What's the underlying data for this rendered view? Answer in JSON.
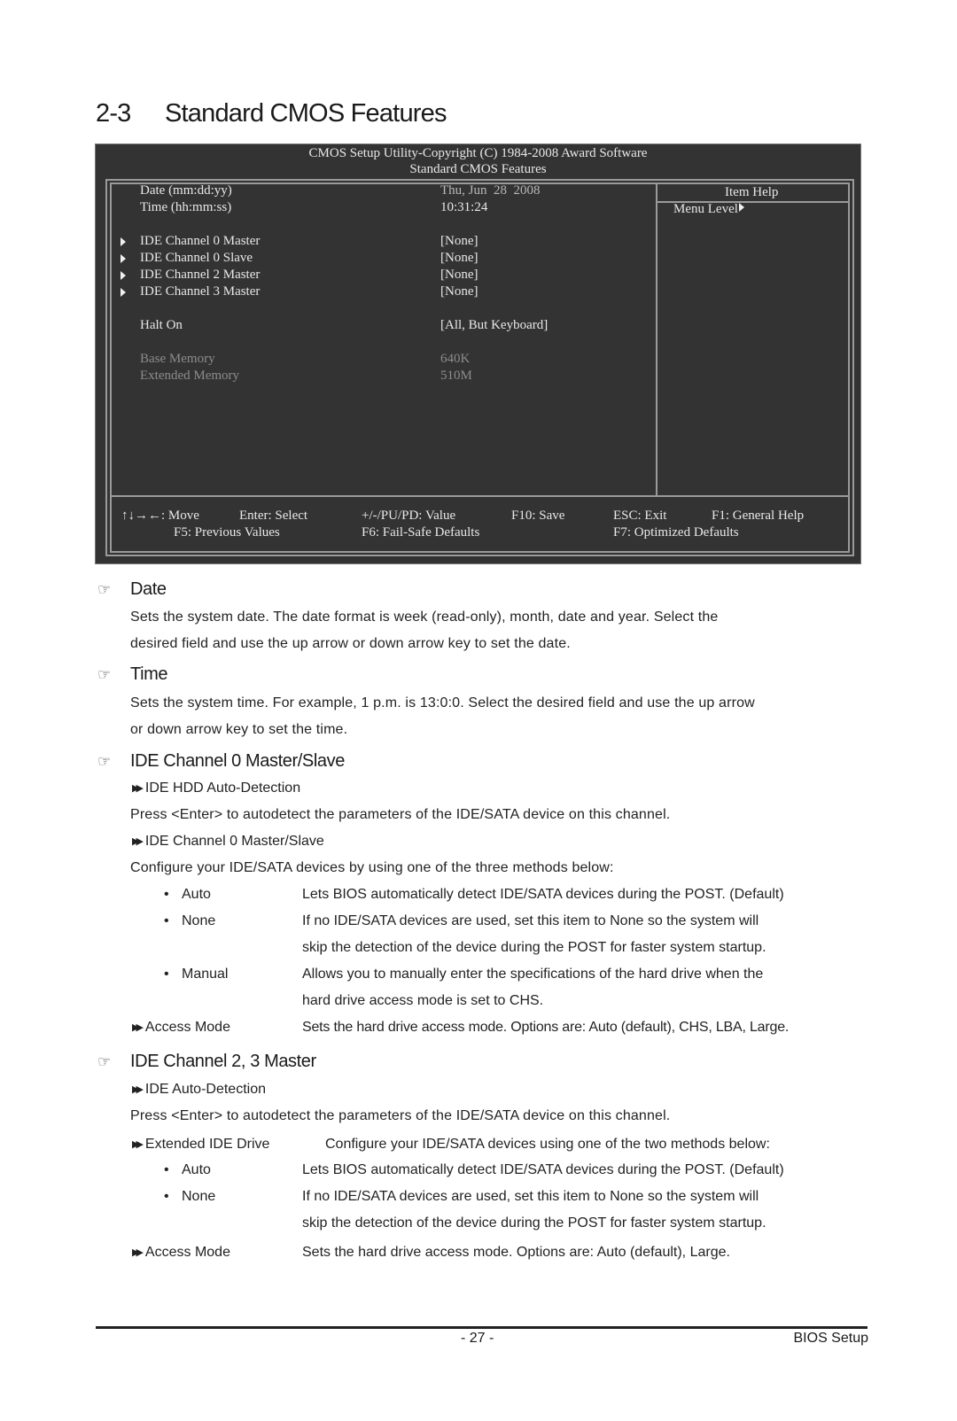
{
  "heading": {
    "number": "2-3",
    "title": "Standard CMOS Features"
  },
  "bios": {
    "header_line1": "CMOS Setup Utility-Copyright (C) 1984-2008 Award Software",
    "header_line2": "Standard CMOS Features",
    "items": [
      {
        "label": "Date (mm:dd:yy)",
        "value": "Thu, Jun  28  2008",
        "submenu": false,
        "state": "normal"
      },
      {
        "label": "Time (hh:mm:ss)",
        "value": "10:31:24",
        "submenu": false,
        "state": "normal"
      },
      {
        "label": "IDE Channel 0 Master",
        "value": "[None]",
        "submenu": true,
        "state": "normal"
      },
      {
        "label": "IDE Channel 0 Slave",
        "value": "[None]",
        "submenu": true,
        "state": "normal"
      },
      {
        "label": "IDE Channel 2 Master",
        "value": "[None]",
        "submenu": true,
        "state": "normal"
      },
      {
        "label": "IDE Channel 3 Master",
        "value": "[None]",
        "submenu": true,
        "state": "normal"
      },
      {
        "label": "Halt On",
        "value": "[All, But Keyboard]",
        "submenu": false,
        "state": "normal"
      },
      {
        "label": "Base Memory",
        "value": "640K",
        "submenu": false,
        "state": "disabled"
      },
      {
        "label": "Extended Memory",
        "value": "510M",
        "submenu": false,
        "state": "disabled"
      }
    ],
    "help": {
      "title": "Item Help",
      "menu_level": "Menu Level"
    },
    "keys_row1": [
      {
        "text": "↑↓→←: Move"
      },
      {
        "text": "Enter: Select"
      },
      {
        "text": "+/-/PU/PD: Value"
      },
      {
        "text": "F10: Save"
      },
      {
        "text": "ESC: Exit"
      },
      {
        "text": "F1: General Help"
      }
    ],
    "keys_row2": [
      {
        "text": "F5: Previous Values"
      },
      {
        "text": "F6: Fail-Safe Defaults"
      },
      {
        "text": "F7: Optimized Defaults"
      }
    ]
  },
  "sections": {
    "date": {
      "title": "Date",
      "lines": [
        "Sets the system date. The date format is week (read-only), month, date and  year.  Select  the",
        "desired field and use the up arrow or down arrow key to set the date."
      ]
    },
    "time": {
      "title": "Time",
      "lines": [
        "Sets the system time. For example, 1 p.m. is 13:0:0. Select the desired field and use the up arrow",
        "or down arrow key to set the time."
      ]
    },
    "ide01": {
      "title": "IDE Channel 0 Master/Slave",
      "auto_detect_label": "IDE HDD Auto-Detection",
      "auto_detect_desc": "Press <Enter> to autodetect the parameters of the IDE/SATA device on this channel.",
      "ms_label": "IDE Channel 0 Master/Slave",
      "ms_desc": "Configure your IDE/SATA devices by using one of the three methods below:",
      "options": [
        {
          "name": "Auto",
          "lines": [
            "Lets BIOS automatically detect IDE/SATA devices during the POST. (Default)"
          ]
        },
        {
          "name": "None",
          "lines": [
            "If no IDE/SATA devices are used, set this item to None so the system will",
            "skip the detection of the device during the POST for faster system startup."
          ]
        },
        {
          "name": "Manual",
          "lines": [
            "Allows you to manually enter the specifications of the hard drive when the",
            "hard drive access mode is set to CHS."
          ]
        }
      ],
      "access_label": "Access Mode",
      "access_desc": "Sets the hard drive access mode. Options are: Auto (default), CHS, LBA, Large."
    },
    "ide23": {
      "title": "IDE Channel 2, 3 Master",
      "auto_detect_label": "IDE Auto-Detection",
      "auto_detect_desc": "Press <Enter> to autodetect the parameters of the IDE/SATA device on this channel.",
      "ext_label": "Extended IDE Drive",
      "ext_desc": "Configure your IDE/SATA devices using one of the two methods below:",
      "options": [
        {
          "name": "Auto",
          "lines": [
            "Lets BIOS automatically detect IDE/SATA devices during the POST. (Default)"
          ]
        },
        {
          "name": "None",
          "lines": [
            "If no IDE/SATA devices are used, set this item to None so the system will",
            "skip the detection of the device during the POST for faster system startup."
          ]
        }
      ],
      "access_label": "Access Mode",
      "access_desc": "Sets the hard drive access mode. Options are: Auto (default), Large."
    }
  },
  "footer": {
    "page": "- 27 -",
    "section": "BIOS Setup"
  },
  "colors": {
    "bios_bg": "#333333",
    "bios_text": "#e8e8e8",
    "bios_disabled": "#8c8c8c",
    "frame": "#9a9a9a"
  }
}
